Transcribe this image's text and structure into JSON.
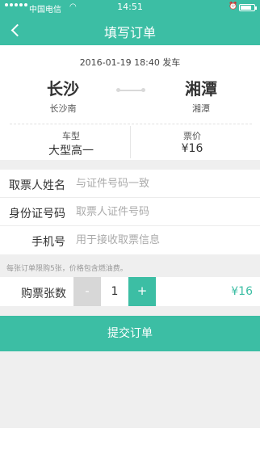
{
  "status_bar": {
    "carrier": "中国电信",
    "time": "14:51",
    "battery_level": 0.8
  },
  "nav": {
    "title": "填写订单",
    "back_icon": "chevron-left-icon"
  },
  "trip": {
    "departure": "2016-01-19 18:40 发车",
    "from_city": "长沙",
    "from_station": "长沙南",
    "to_city": "湘潭",
    "to_station": "湘潭",
    "bus_type_label": "车型",
    "bus_type": "大型高一",
    "price_label": "票价",
    "price": "¥16"
  },
  "form": {
    "name_label": "取票人姓名",
    "name_placeholder": "与证件号码一致",
    "id_label": "身份证号码",
    "id_placeholder": "取票人证件号码",
    "phone_label": "手机号",
    "phone_placeholder": "用于接收取票信息"
  },
  "notice": "每张订单限购5张，价格包含燃油费。",
  "quantity": {
    "label": "购票张数",
    "minus": "-",
    "value": "1",
    "plus": "+",
    "total": "¥16"
  },
  "submit_label": "提交订单",
  "colors": {
    "accent": "#3cbea4",
    "background": "#efefef",
    "disabled": "#d7d7d7"
  }
}
